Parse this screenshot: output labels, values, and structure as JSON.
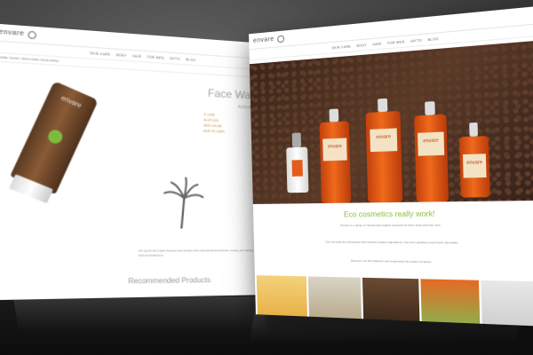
{
  "brand": {
    "logo_text": "envare",
    "logo_icon": "leaf-circle-icon"
  },
  "left_page": {
    "nav_items": [
      "SKIN CARE",
      "BODY",
      "HAIR",
      "FOR MEN",
      "GIFTS",
      "BLOG"
    ],
    "breadcrumb": "HOME / SHOP / SKIN CARE / FACE WASH",
    "product_title": "Face Wash",
    "product_subtitle": "Activated",
    "price_line": "₹ 1,099",
    "detail_lines": [
      "IN STOCK",
      "SIZE 100 ML",
      "ADD TO CART"
    ],
    "palm_icon": "palm-tree-icon",
    "description": "Our gentle face wash cleanses and purifies with natural botanical extracts, leaving skin feeling fresh and balanced.",
    "recommended_heading": "Recommended Products",
    "tube_brand": "envare"
  },
  "right_page": {
    "nav_items": [
      "SKIN CARE",
      "BODY",
      "HAIR",
      "FOR MEN",
      "GIFTS",
      "BLOG"
    ],
    "eco_heading": "Eco cosmetics really work!",
    "paragraph_1": "Envare is a range of natural and organic products for face, body and hair care.",
    "paragraph_2": "Our formulas are developed with certified organic ingredients, free from parabens and harsh chemicals.",
    "paragraph_3": "Discover our full collection and experience the power of nature.",
    "bottle_label": "envare"
  },
  "colors": {
    "accent_green": "#8bbd3d",
    "orange": "#f06a1c",
    "brown": "#5a3a26"
  }
}
